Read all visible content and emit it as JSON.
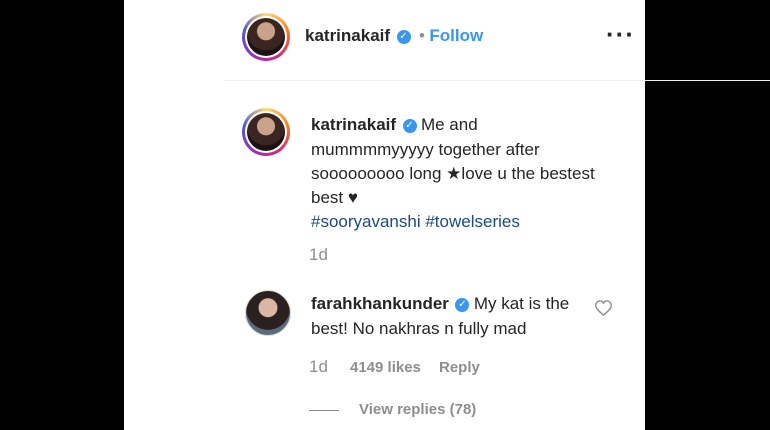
{
  "header": {
    "username": "katrinakaif",
    "separator": "•",
    "follow_label": "Follow",
    "more_icon": "more-options-icon"
  },
  "post": {
    "username": "katrinakaif",
    "caption_lines": [
      "Me and",
      "mummmmyyyyy together after",
      "sooooooooo long ★love u the bestest",
      "best ♥"
    ],
    "hashtags": "#sooryavanshi #towelseries",
    "age": "1d"
  },
  "comment": {
    "username": "farahkhankunder",
    "text_lines": [
      "My kat is the",
      "best! No nakhras n fully mad"
    ],
    "age": "1d",
    "likes": "4149 likes",
    "reply_label": "Reply",
    "view_replies": "View replies (78)"
  },
  "colors": {
    "link_blue": "#3897f0",
    "hashtag_blue": "#1a4b82",
    "muted": "#8e8e8e"
  }
}
